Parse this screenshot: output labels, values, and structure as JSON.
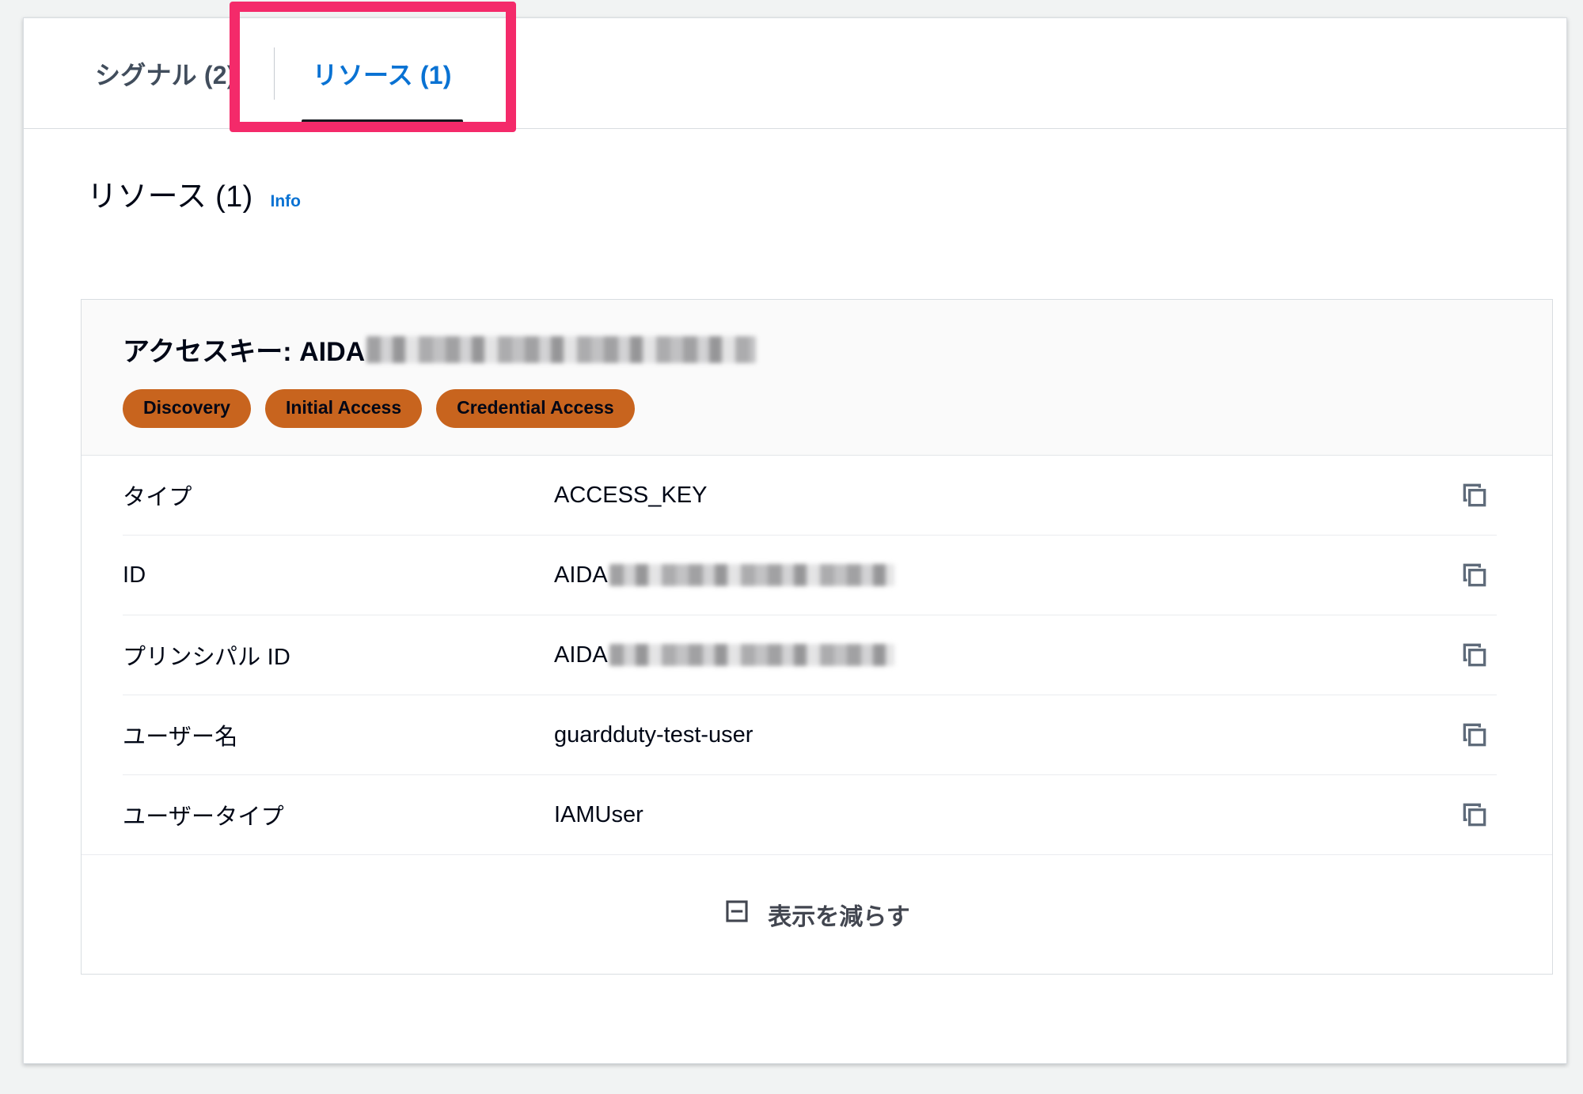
{
  "tabs": [
    {
      "label": "シグナル (2)",
      "active": false,
      "name": "tab-signals"
    },
    {
      "label": "リソース (1)",
      "active": true,
      "name": "tab-resources"
    }
  ],
  "section": {
    "title": "リソース (1)",
    "info_label": "Info"
  },
  "card": {
    "title_prefix": "アクセスキー: AIDA",
    "title_redacted": true,
    "badges": [
      {
        "label": "Discovery"
      },
      {
        "label": "Initial Access"
      },
      {
        "label": "Credential Access"
      }
    ],
    "rows": [
      {
        "label": "タイプ",
        "value": "ACCESS_KEY",
        "redacted": false,
        "copy_icon": "copy-icon"
      },
      {
        "label": "ID",
        "value": "AIDA",
        "redacted": true,
        "copy_icon": "copy-icon"
      },
      {
        "label": "プリンシパル ID",
        "value": "AIDA",
        "redacted": true,
        "copy_icon": "copy-icon"
      },
      {
        "label": "ユーザー名",
        "value": "guardduty-test-user",
        "redacted": false,
        "copy_icon": "copy-icon"
      },
      {
        "label": "ユーザータイプ",
        "value": "IAMUser",
        "redacted": false,
        "copy_icon": "copy-icon"
      }
    ],
    "footer": {
      "label": "表示を減らす",
      "icon": "minus-square-icon"
    }
  },
  "colors": {
    "accent_blue": "#0972d3",
    "badge_orange": "#c8641e",
    "highlight_pink": "#f42a6a",
    "text_primary": "#000716",
    "text_secondary": "#414d5c",
    "page_background": "#f1f3f3",
    "card_header_background": "#fafafa",
    "border": "#d9dde1"
  }
}
